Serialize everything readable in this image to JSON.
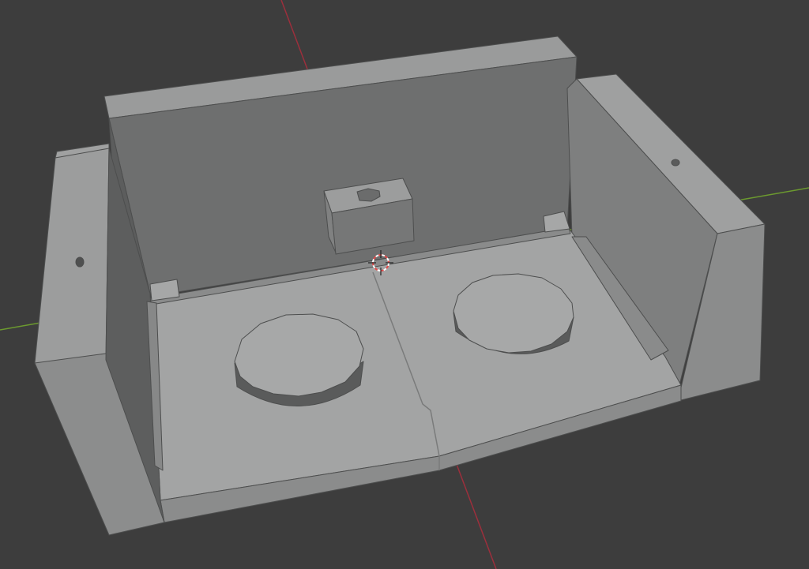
{
  "viewport": {
    "background_color": "#3d3d3d",
    "axis_colors": {
      "x_axis": "#9c2f3c",
      "y_axis": "#6c9a2f"
    },
    "model_colors": {
      "top_light": "#a4a5a5",
      "face_mid": "#8f9090",
      "face_dark": "#6c6d6d",
      "face_shadow": "#5b5c5c",
      "edge": "#4d4e4e"
    },
    "cursor": {
      "name": "3d-cursor",
      "colors": [
        "#e34a4a",
        "#ffffff"
      ]
    }
  }
}
